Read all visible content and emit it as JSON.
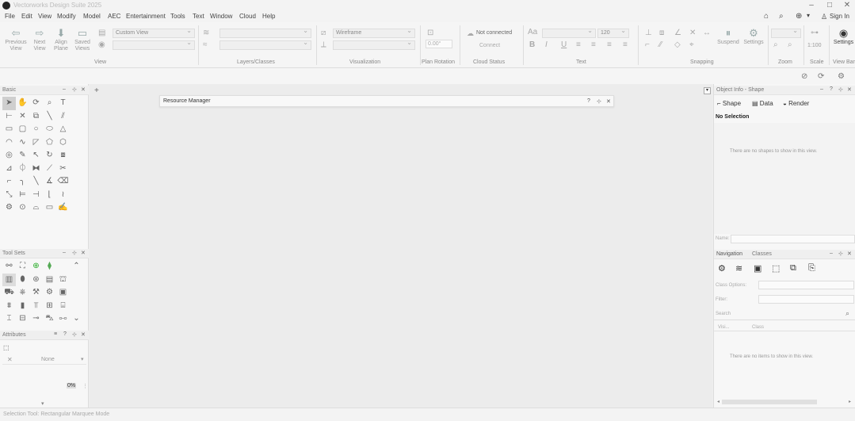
{
  "app": {
    "title": "Vectorworks Design Suite 2025"
  },
  "menu": [
    "File",
    "Edit",
    "View",
    "Modify",
    "Model",
    "AEC",
    "Entertainment",
    "Tools",
    "Text",
    "Window",
    "Cloud",
    "Help"
  ],
  "header": {
    "signin": "Sign In"
  },
  "ribbon": {
    "view_group": {
      "previous": "Previous View",
      "next": "Next View",
      "align_plane": "Align Plane",
      "saved_views": "Saved Views",
      "view_dropdown": "Custom View",
      "label": "View"
    },
    "layers_group": {
      "label": "Layers/Classes"
    },
    "visualization_group": {
      "render_mode": "Wireframe",
      "label": "Visualization"
    },
    "plan_rotation": {
      "value": "0.00°",
      "label": "Plan Rotation"
    },
    "cloud": {
      "status_text": "Not connected",
      "connect": "Connect",
      "label": "Cloud Status"
    },
    "text_group": {
      "font_size": "120",
      "label": "Text"
    },
    "snapping": {
      "suspend": "Suspend",
      "settings": "Settings",
      "label": "Snapping"
    },
    "zoom": {
      "label": "Zoom"
    },
    "scale": {
      "value": "1:100",
      "label": "Scale"
    },
    "viewbar": {
      "settings": "Settings",
      "label": "View Bar"
    }
  },
  "left_panel": {
    "basic": {
      "title": "Basic"
    },
    "tool_sets": {
      "title": "Tool Sets"
    },
    "attributes": {
      "title": "Attributes",
      "fill_value": "None",
      "opacity": "0%"
    }
  },
  "canvas": {
    "resource_manager_title": "Resource Manager"
  },
  "right_panel": {
    "obj_info": {
      "title": "Object Info - Shape",
      "tabs": [
        "Shape",
        "Data",
        "Render"
      ],
      "selection": "No Selection",
      "empty_msg": "There are no shapes to show in this view.",
      "name_label": "Name:"
    },
    "navigation": {
      "tabs": [
        "Navigation",
        "Classes"
      ],
      "class_options_label": "Class Options:",
      "filter_label": "Filter:",
      "search_placeholder": "Search",
      "columns": [
        "Visi...",
        "Class"
      ],
      "empty_msg": "There are no items to show in this view."
    }
  },
  "status": {
    "text": "Selection Tool: Rectangular Marquee Mode"
  }
}
